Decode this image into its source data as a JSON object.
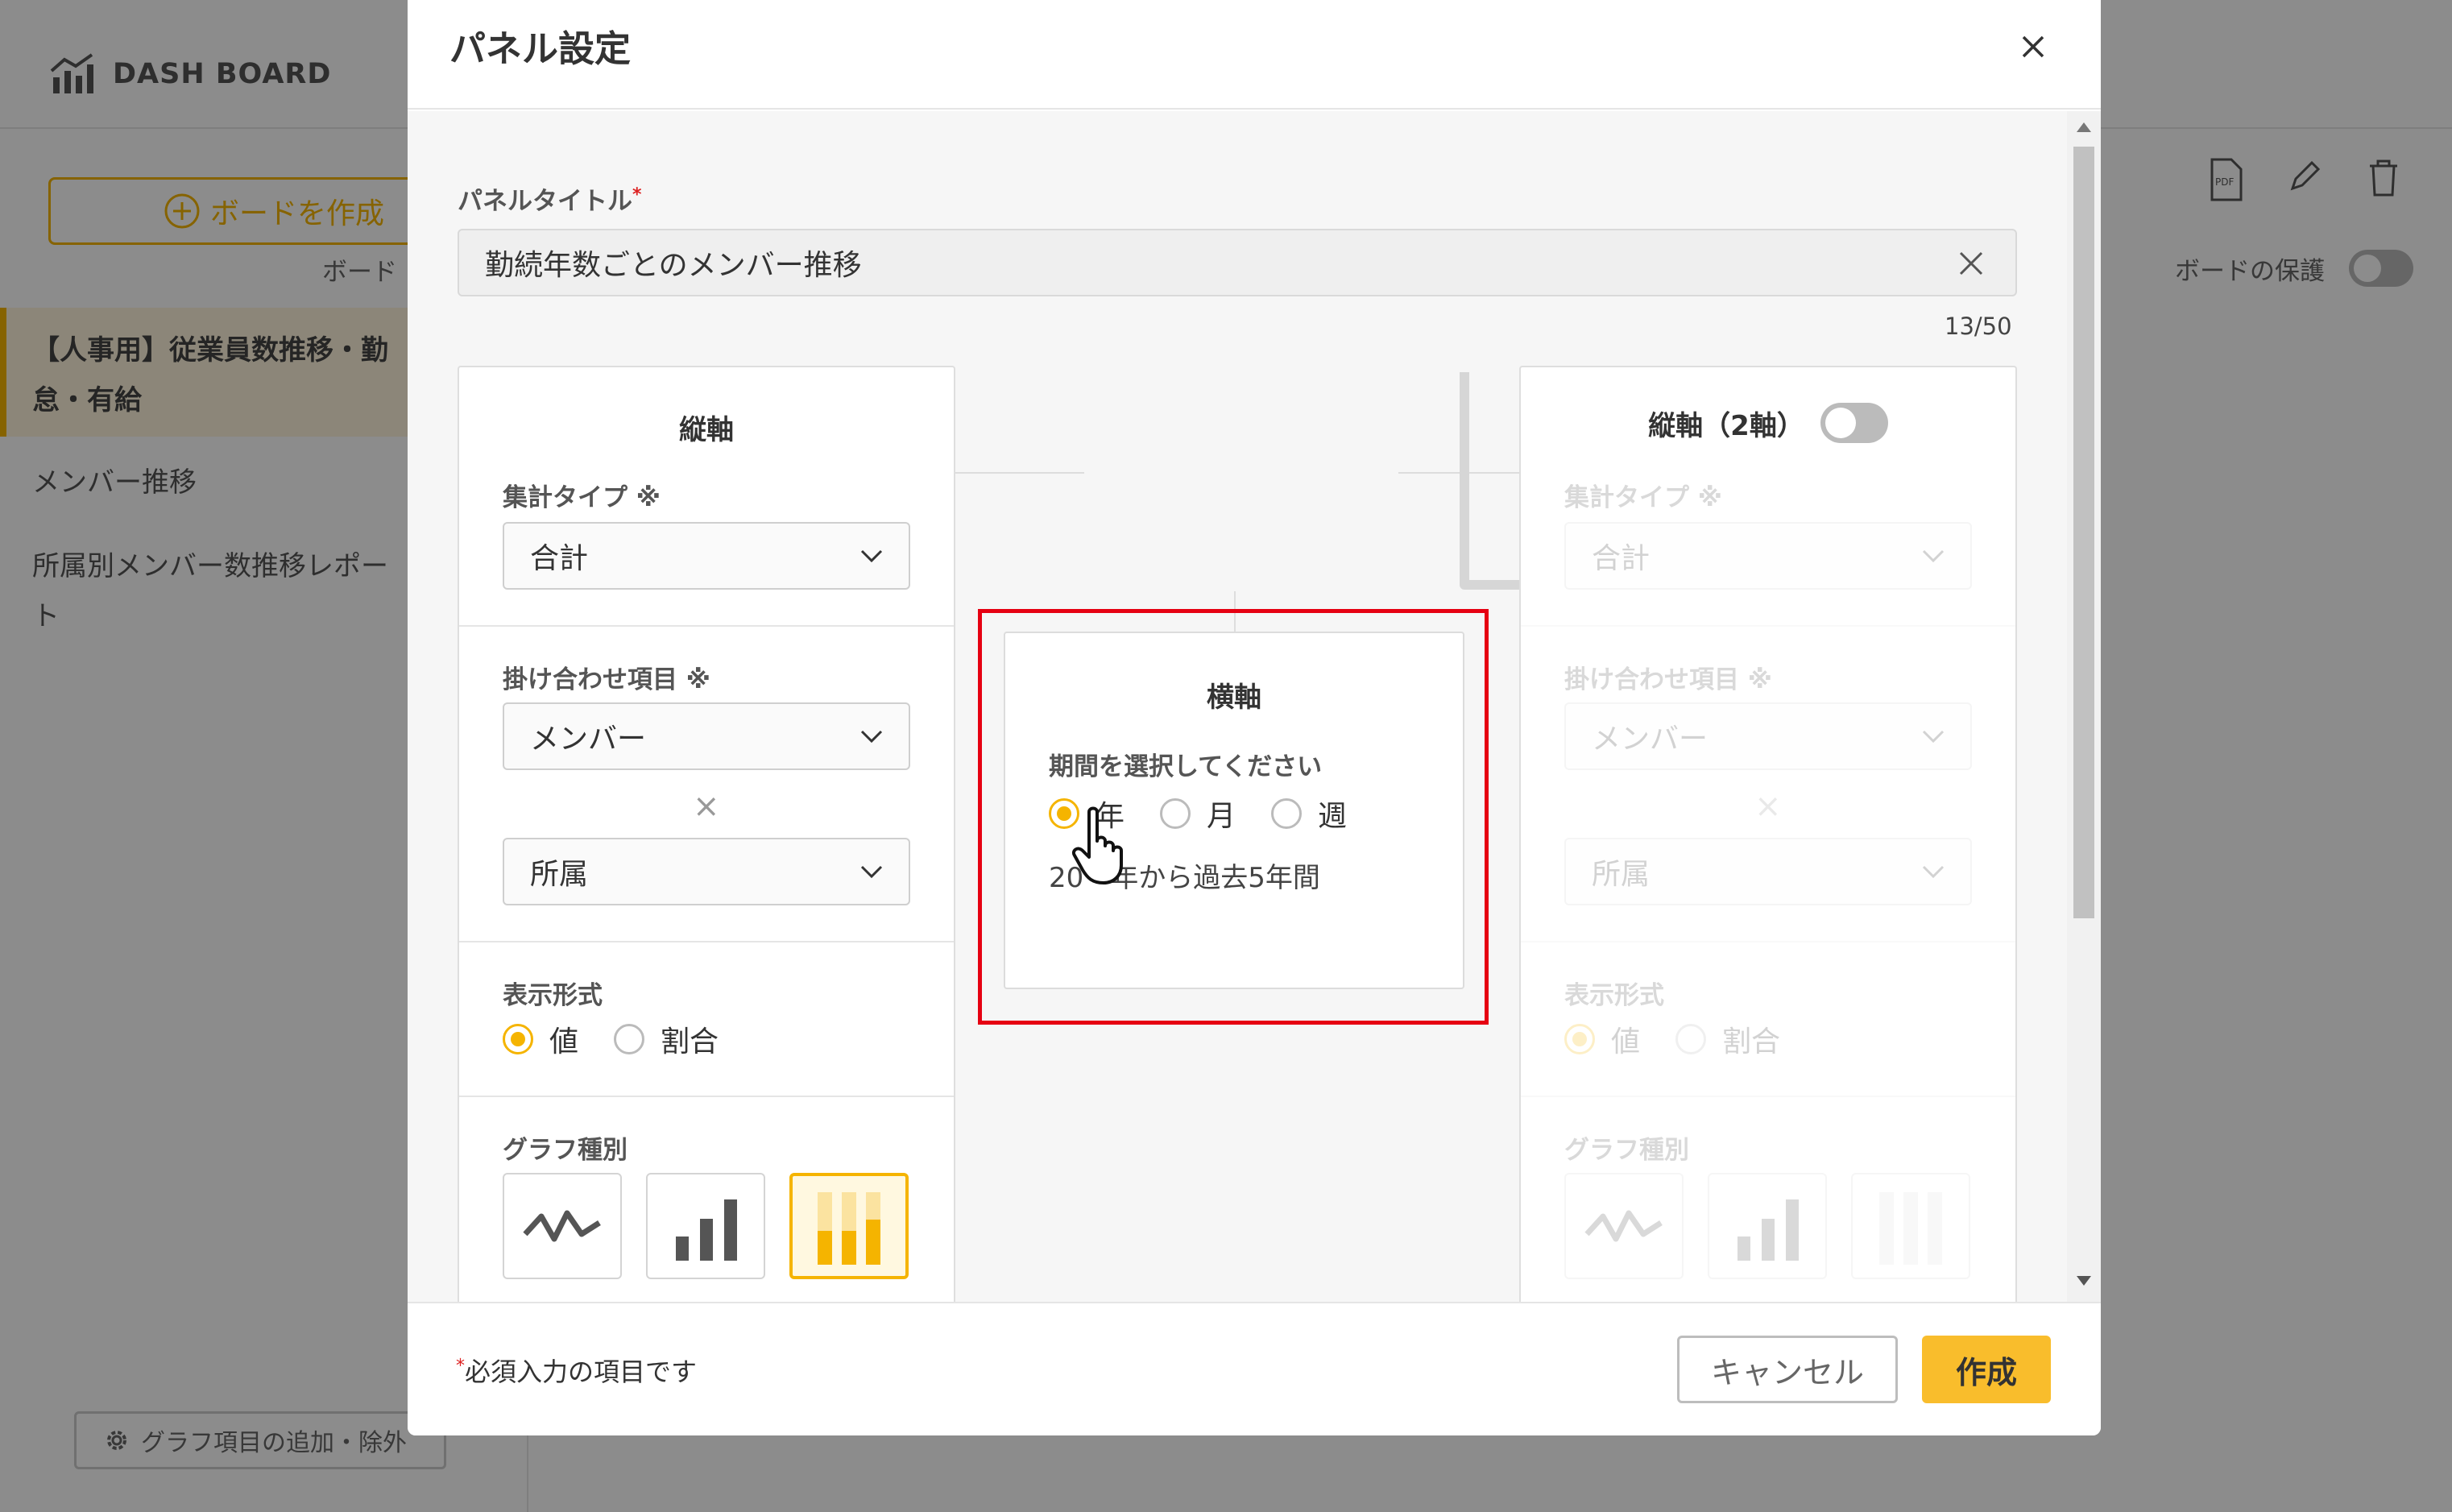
{
  "app": {
    "logo_text": "DASH BOARD",
    "create_board_label": "ボードを作成",
    "board_hint": "ボード",
    "boards": [
      {
        "label": "【人事用】従業員数推移・勤",
        "label2": "怠・有給"
      },
      {
        "label": "メンバー推移"
      },
      {
        "label": "所属別メンバー数推移レポー",
        "label2": "ト"
      }
    ],
    "graph_edit_label": "グラフ項目の追加・除外",
    "protect_label": "ボードの保護"
  },
  "modal": {
    "title": "パネル設定",
    "panel_title_label": "パネルタイトル",
    "required_mark": "*",
    "panel_title_value": "勤続年数ごとのメンバー推移",
    "counter": "13/50",
    "left_axis": {
      "title": "縦軸",
      "agg_type_label": "集計タイプ ※",
      "agg_type_value": "合計",
      "combo_label": "掛け合わせ項目 ※",
      "combo_value_1": "メンバー",
      "combo_x": "×",
      "combo_value_2": "所属",
      "display_label": "表示形式",
      "display_options": [
        "値",
        "割合"
      ],
      "display_selected": "値",
      "graph_type_label": "グラフ種別"
    },
    "right_axis": {
      "title": "縦軸（2軸）",
      "agg_type_label": "集計タイプ ※",
      "agg_type_value": "合計",
      "combo_label": "掛け合わせ項目 ※",
      "combo_value_1": "メンバー",
      "combo_x": "×",
      "combo_value_2": "所属",
      "display_label": "表示形式",
      "display_options": [
        "値",
        "割合"
      ],
      "graph_type_label": "グラフ種別"
    },
    "horizontal_axis": {
      "title": "横軸",
      "period_label": "期間を選択してください",
      "options": [
        "年",
        "月",
        "週"
      ],
      "selected": "年",
      "range_text": "20　年から過去5年間"
    },
    "footer_note": "必須入力の項目です",
    "cancel_label": "キャンセル",
    "create_label": "作成"
  },
  "colors": {
    "accent": "#f5b400",
    "highlight": "#e60012"
  }
}
